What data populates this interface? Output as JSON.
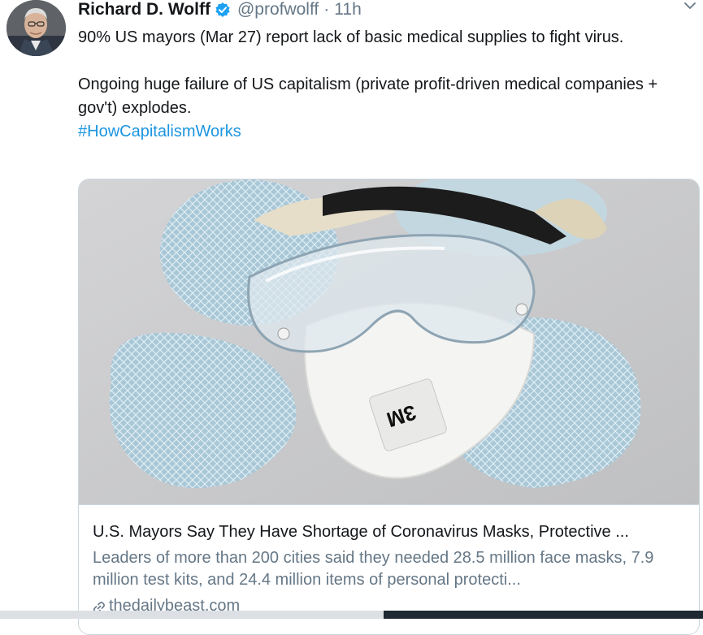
{
  "author": {
    "name": "Richard D. Wolff",
    "handle": "@profwolff",
    "separator": "·",
    "time": "11h"
  },
  "tweet": {
    "line1": "90% US mayors (Mar 27) report lack of basic medical supplies to fight virus.",
    "line2": "Ongoing huge failure of US capitalism (private profit-driven medical companies + gov't) explodes.",
    "hashtag": "#HowCapitalismWorks"
  },
  "card": {
    "title": "U.S. Mayors Say They Have Shortage of Coronavirus Masks, Protective ...",
    "description": "Leaders of more than 200 cities said they needed 28.5 million face masks, 7.9 million test kits, and 24.4 million items of personal protecti...",
    "domain": "thedailybeast.com",
    "image_brand": "3M"
  },
  "icons": {
    "verified": "verified-badge-icon",
    "caret": "chevron-down-icon",
    "link": "link-icon"
  },
  "colors": {
    "link_blue": "#1b95e0",
    "secondary_text": "#657786",
    "verified_blue": "#1da1f2"
  }
}
